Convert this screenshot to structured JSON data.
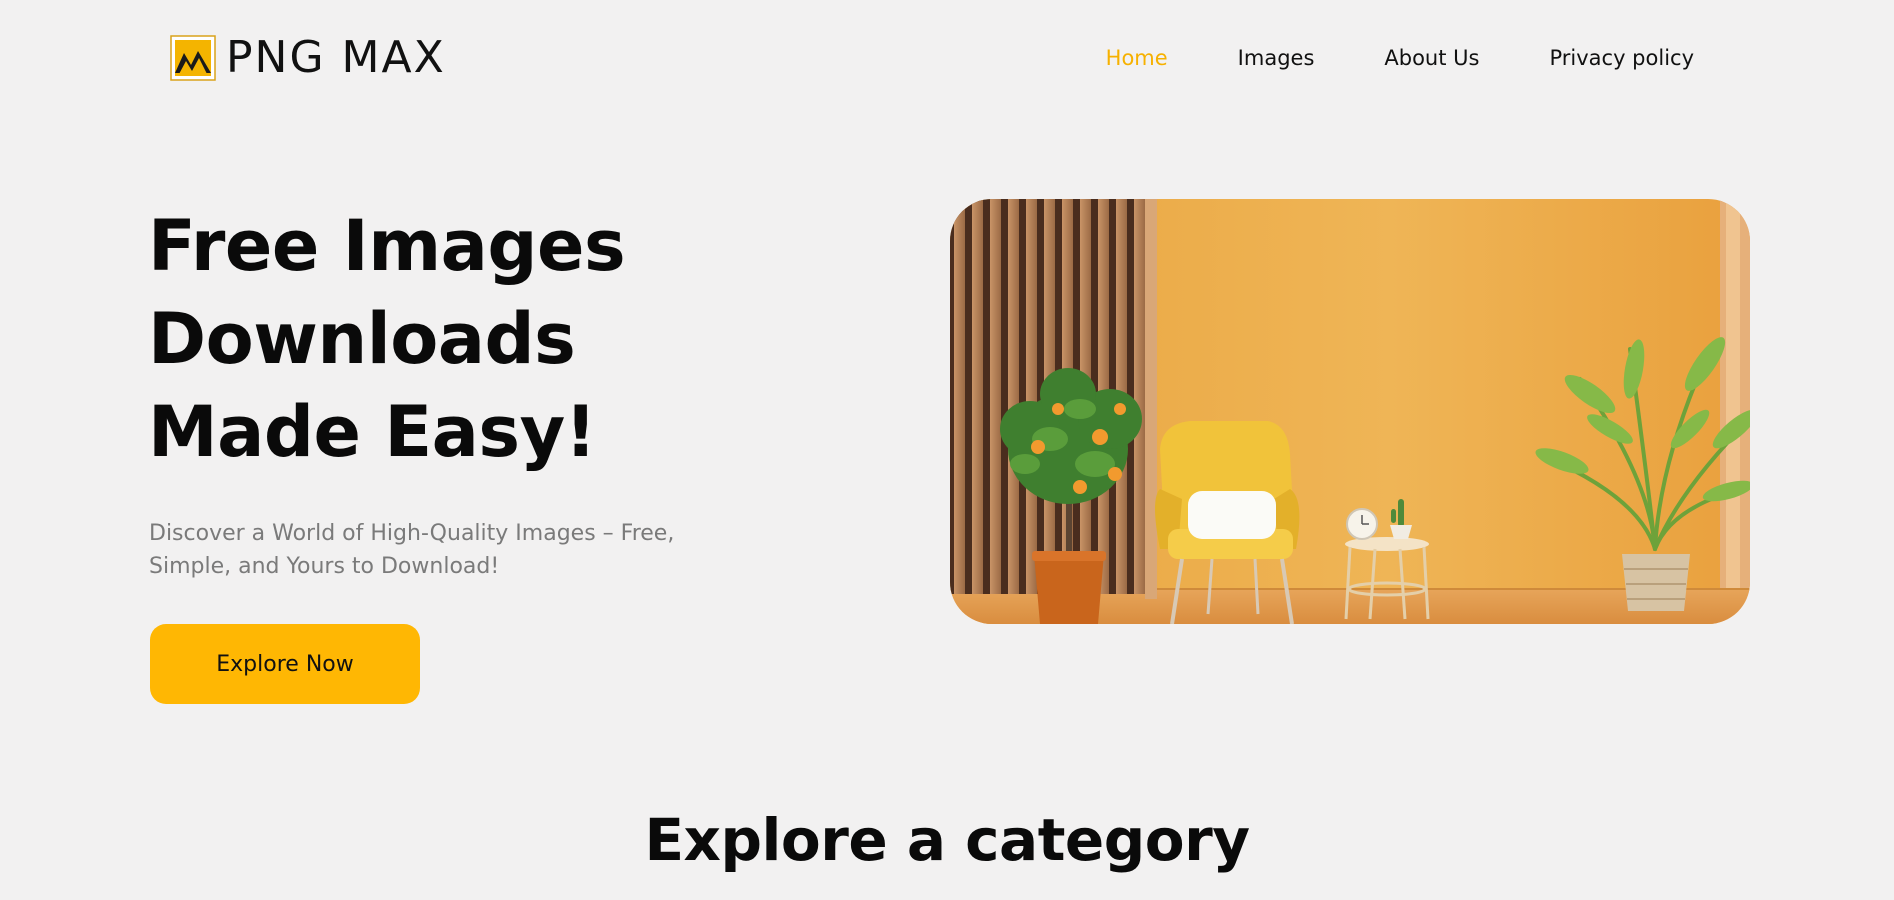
{
  "brand": {
    "name": "PNG MAX"
  },
  "nav": {
    "items": [
      {
        "label": "Home",
        "active": true
      },
      {
        "label": "Images",
        "active": false
      },
      {
        "label": "About Us",
        "active": false
      },
      {
        "label": "Privacy policy",
        "active": false
      }
    ]
  },
  "hero": {
    "title_lines": [
      "Free Images",
      "Downloads",
      "Made Easy!"
    ],
    "subtitle": "Discover a World of High-Quality Images – Free, Simple, and Yours to Download!",
    "cta_label": "Explore Now",
    "image_subject": "orange-room-interior"
  },
  "sections": {
    "category_title": "Explore a category"
  },
  "colors": {
    "accent": "#ffb703",
    "nav_active": "#f6b100",
    "background": "#f2f1f1",
    "subtitle_text": "#7a7a7a"
  }
}
